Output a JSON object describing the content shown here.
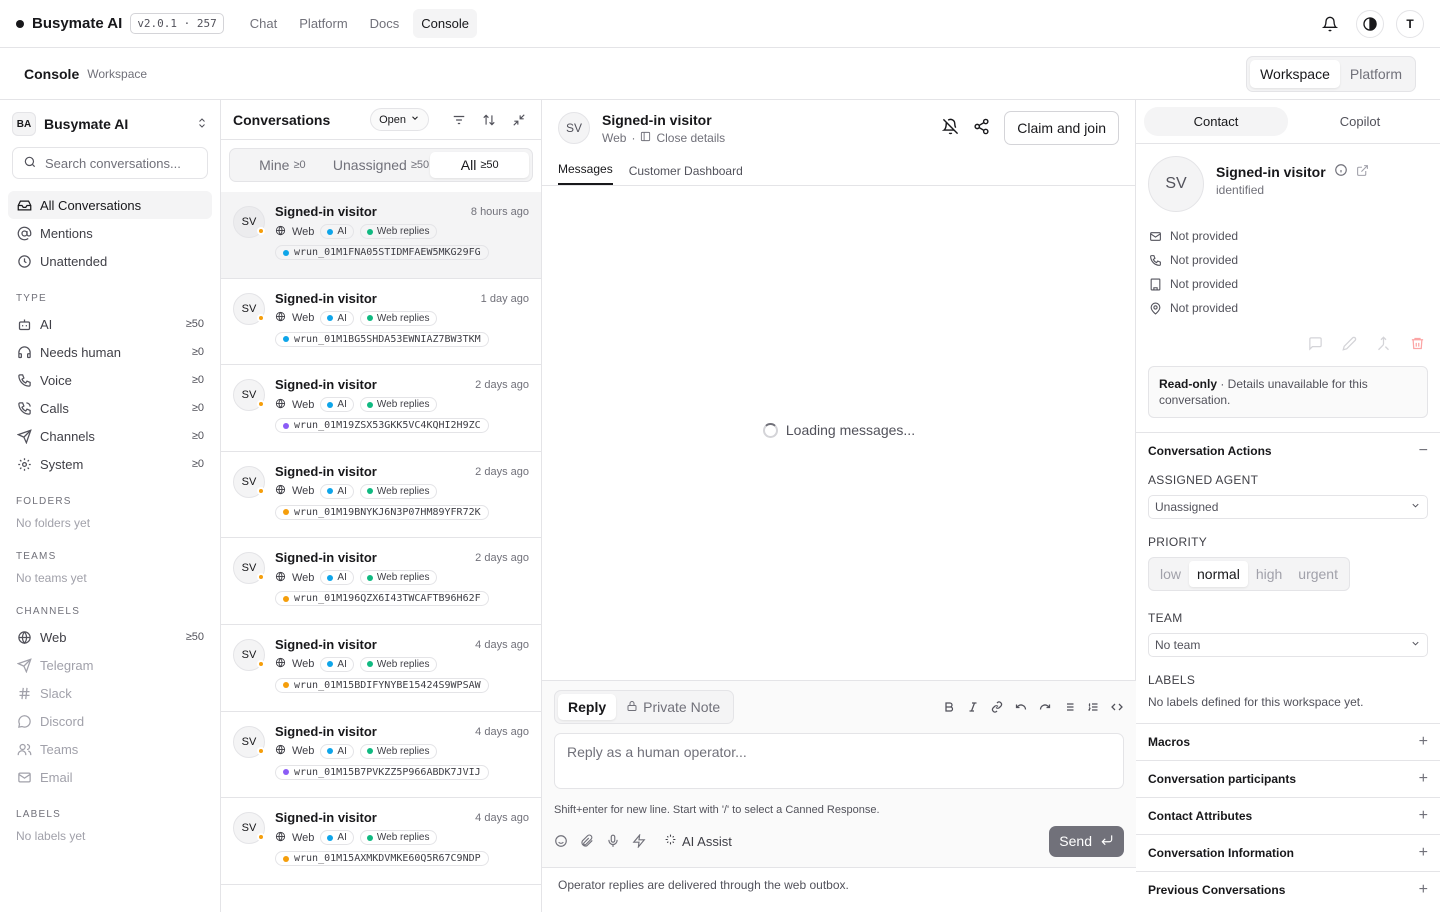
{
  "topnav": {
    "brand": "Busymate AI",
    "version": "v2.0.1 · 257",
    "links": [
      "Chat",
      "Platform",
      "Docs",
      "Console"
    ],
    "user_initial": "T"
  },
  "subheader": {
    "title": "Console",
    "subtitle": "Workspace",
    "toggle": [
      "Workspace",
      "Platform"
    ]
  },
  "sidebar": {
    "workspace_badge": "BA",
    "workspace_name": "Busymate AI",
    "search_placeholder": "Search conversations...",
    "main": [
      "All Conversations",
      "Mentions",
      "Unattended"
    ],
    "type_label": "TYPE",
    "types": [
      {
        "label": "AI",
        "count": "≥50"
      },
      {
        "label": "Needs human",
        "count": "≥0"
      },
      {
        "label": "Voice",
        "count": "≥0"
      },
      {
        "label": "Calls",
        "count": "≥0"
      },
      {
        "label": "Channels",
        "count": "≥0"
      },
      {
        "label": "System",
        "count": "≥0"
      }
    ],
    "folders_label": "FOLDERS",
    "folders_empty": "No folders yet",
    "teams_label": "TEAMS",
    "teams_empty": "No teams yet",
    "channels_label": "CHANNELS",
    "channels": [
      {
        "label": "Web",
        "count": "≥50"
      },
      {
        "label": "Telegram",
        "count": ""
      },
      {
        "label": "Slack",
        "count": ""
      },
      {
        "label": "Discord",
        "count": ""
      },
      {
        "label": "Teams",
        "count": ""
      },
      {
        "label": "Email",
        "count": ""
      }
    ],
    "labels_label": "LABELS",
    "labels_empty": "No labels yet"
  },
  "conversations": {
    "title": "Conversations",
    "status": "Open",
    "tabs": [
      {
        "label": "Mine",
        "count": "≥0"
      },
      {
        "label": "Unassigned",
        "count": "≥50"
      },
      {
        "label": "All",
        "count": "≥50"
      }
    ],
    "items": [
      {
        "initials": "SV",
        "name": "Signed-in visitor",
        "time": "8 hours ago",
        "channel": "Web",
        "ai": "AI",
        "replies": "Web replies",
        "run": "wrun_01M1FNA05STIDMFAEW5MKG29FG",
        "run_color": "#0ea5e9"
      },
      {
        "initials": "SV",
        "name": "Signed-in visitor",
        "time": "1 day ago",
        "channel": "Web",
        "ai": "AI",
        "replies": "Web replies",
        "run": "wrun_01M1BG5SHDA53EWNIAZ7BW3TKM",
        "run_color": "#0ea5e9"
      },
      {
        "initials": "SV",
        "name": "Signed-in visitor",
        "time": "2 days ago",
        "channel": "Web",
        "ai": "AI",
        "replies": "Web replies",
        "run": "wrun_01M19ZSX53GKK5VC4KQHI2H9ZC",
        "run_color": "#8b5cf6"
      },
      {
        "initials": "SV",
        "name": "Signed-in visitor",
        "time": "2 days ago",
        "channel": "Web",
        "ai": "AI",
        "replies": "Web replies",
        "run": "wrun_01M19BNYKJ6N3P07HM89YFR72K",
        "run_color": "#f59e0b"
      },
      {
        "initials": "SV",
        "name": "Signed-in visitor",
        "time": "2 days ago",
        "channel": "Web",
        "ai": "AI",
        "replies": "Web replies",
        "run": "wrun_01M196QZX6I43TWCAFTB96H62F",
        "run_color": "#f59e0b"
      },
      {
        "initials": "SV",
        "name": "Signed-in visitor",
        "time": "4 days ago",
        "channel": "Web",
        "ai": "AI",
        "replies": "Web replies",
        "run": "wrun_01M15BDIFYNYBE15424S9WPSAW",
        "run_color": "#f59e0b"
      },
      {
        "initials": "SV",
        "name": "Signed-in visitor",
        "time": "4 days ago",
        "channel": "Web",
        "ai": "AI",
        "replies": "Web replies",
        "run": "wrun_01M15B7PVKZZ5P966ABDK7JVIJ",
        "run_color": "#8b5cf6"
      },
      {
        "initials": "SV",
        "name": "Signed-in visitor",
        "time": "4 days ago",
        "channel": "Web",
        "ai": "AI",
        "replies": "Web replies",
        "run": "wrun_01M15AXMKDVMKE60Q5R67C9NDP",
        "run_color": "#f59e0b"
      }
    ]
  },
  "main": {
    "initials": "SV",
    "name": "Signed-in visitor",
    "channel": "Web",
    "close_details": "Close details",
    "claim": "Claim and join",
    "tabs": [
      "Messages",
      "Customer Dashboard"
    ],
    "loading": "Loading messages...",
    "composer": {
      "modes": [
        "Reply",
        "Private Note"
      ],
      "placeholder": "Reply as a human operator...",
      "hint": "Shift+enter for new line. Start with '/' to select a Canned Response.",
      "ai_assist": "AI Assist",
      "send": "Send"
    },
    "footer": "Operator replies are delivered through the web outbox."
  },
  "rpanel": {
    "tabs": [
      "Contact",
      "Copilot"
    ],
    "initials": "SV",
    "name": "Signed-in visitor",
    "status": "identified",
    "fields": [
      "Not provided",
      "Not provided",
      "Not provided",
      "Not provided"
    ],
    "readonly_bold": "Read-only",
    "readonly_text": " · Details unavailable for this conversation.",
    "actions_title": "Conversation Actions",
    "agent_label": "ASSIGNED AGENT",
    "agent_value": "Unassigned",
    "priority_label": "PRIORITY",
    "priorities": [
      "low",
      "normal",
      "high",
      "urgent"
    ],
    "team_label": "TEAM",
    "team_value": "No team",
    "labels_label": "LABELS",
    "labels_empty": "No labels defined for this workspace yet.",
    "sections": [
      "Macros",
      "Conversation participants",
      "Contact Attributes",
      "Conversation Information",
      "Previous Conversations"
    ]
  }
}
